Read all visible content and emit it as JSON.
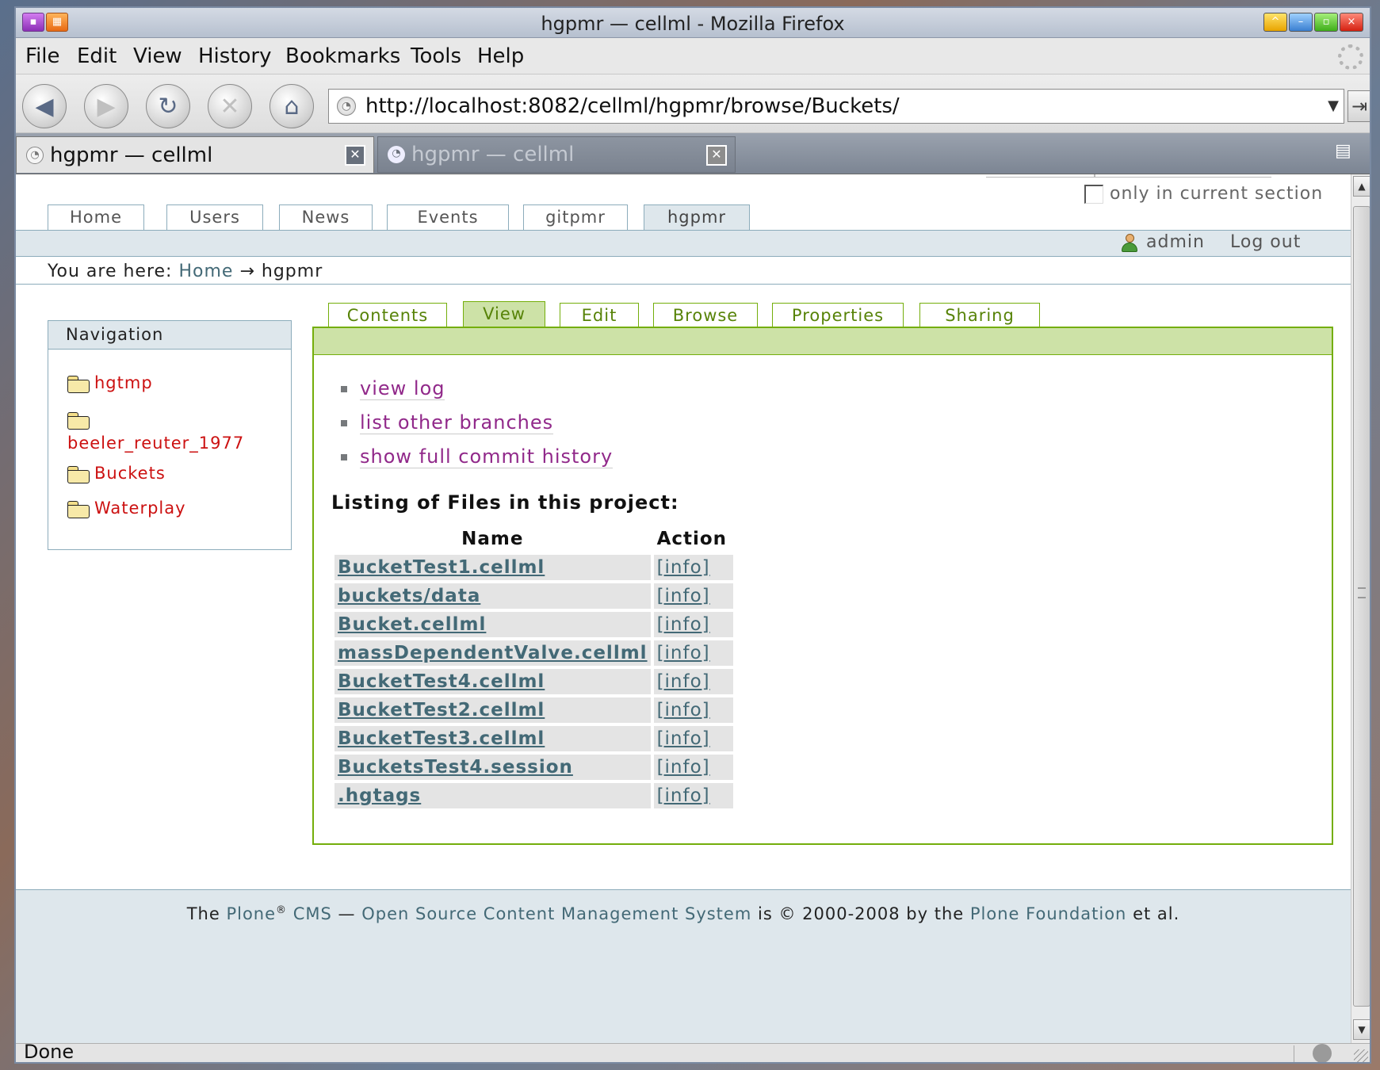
{
  "window": {
    "title": "hgpmr — cellml - Mozilla Firefox"
  },
  "menu": [
    {
      "label": "File"
    },
    {
      "label": "Edit"
    },
    {
      "label": "View"
    },
    {
      "label": "History"
    },
    {
      "label": "Bookmarks"
    },
    {
      "label": "Tools"
    },
    {
      "label": "Help"
    }
  ],
  "navbar": {
    "url": "http://localhost:8082/cellml/hgpmr/browse/Buckets/"
  },
  "browser_tabs": [
    {
      "label": "hgpmr — cellml",
      "active": true
    },
    {
      "label": "hgpmr — cellml",
      "active": false
    }
  ],
  "site": {
    "search_option_label": "only in current section",
    "portal_tabs": [
      "Home",
      "Users",
      "News",
      "Events",
      "gitpmr",
      "hgpmr"
    ],
    "selected_portal_tab": "hgpmr",
    "user": "admin",
    "logout": "Log out",
    "breadcrumb": {
      "prefix": "You are here:",
      "home": "Home",
      "arrow": "→",
      "current": "hgpmr"
    },
    "navigation": {
      "title": "Navigation",
      "items": [
        "hgtmp",
        "beeler_reuter_1977",
        "Buckets",
        "Waterplay"
      ]
    },
    "content_tabs": [
      "Contents",
      "View",
      "Edit",
      "Browse",
      "Properties",
      "Sharing"
    ],
    "selected_content_tab": "View",
    "links": [
      "view log",
      "list other branches",
      "show full commit history"
    ],
    "listing_title": "Listing of Files in this project:",
    "table": {
      "headers": [
        "Name",
        "Action"
      ],
      "rows": [
        {
          "name": "BucketTest1.cellml",
          "action": "[info]"
        },
        {
          "name": "buckets/data",
          "action": "[info]"
        },
        {
          "name": "Bucket.cellml",
          "action": "[info]"
        },
        {
          "name": "massDependentValve.cellml",
          "action": "[info]"
        },
        {
          "name": "BucketTest4.cellml",
          "action": "[info]"
        },
        {
          "name": "BucketTest2.cellml",
          "action": "[info]"
        },
        {
          "name": "BucketTest3.cellml",
          "action": "[info]"
        },
        {
          "name": "BucketsTest4.session",
          "action": "[info]"
        },
        {
          "name": ".hgtags",
          "action": "[info]"
        }
      ]
    },
    "footer": {
      "t1": "The",
      "plone": "Plone",
      "reg": "®",
      "cms": "CMS",
      "dash": "—",
      "oss": "Open Source Content Management System",
      "is": "is",
      "copy": "©",
      "years": "2000-2008 by the",
      "foundation": "Plone Foundation",
      "etal": "et al."
    }
  },
  "status": {
    "text": "Done"
  }
}
